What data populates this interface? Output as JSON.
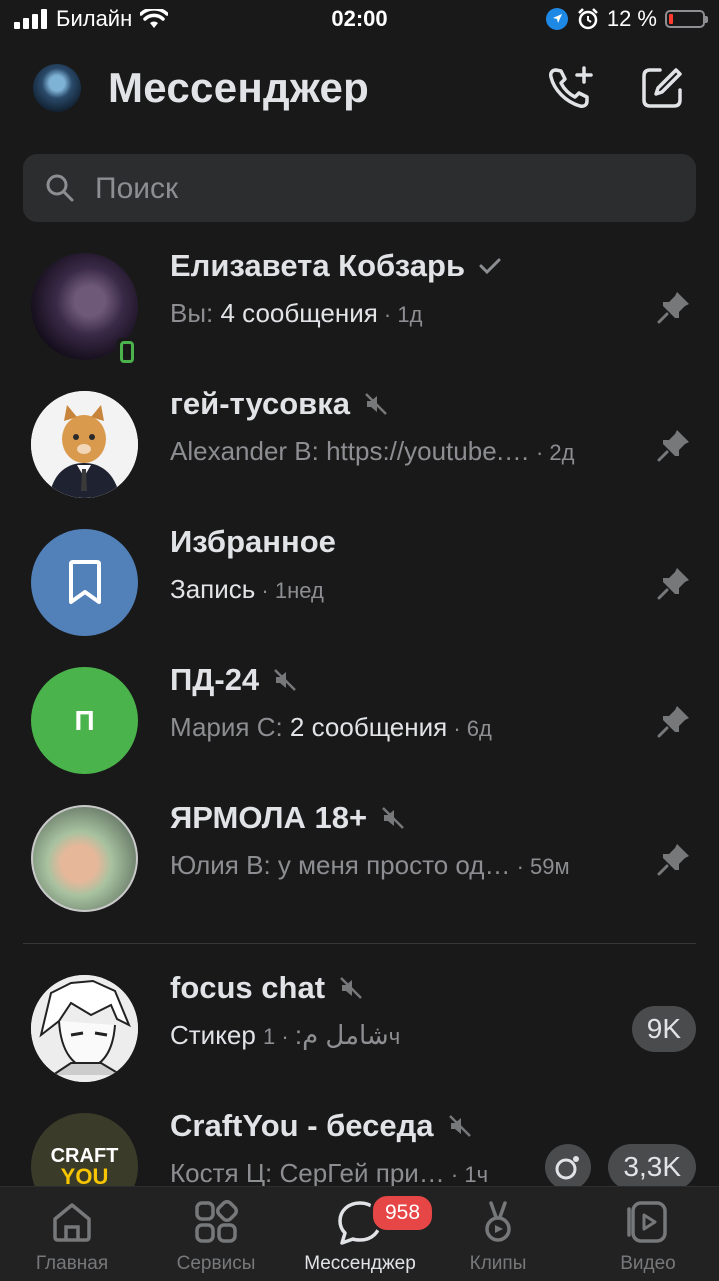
{
  "status_bar": {
    "carrier": "Билайн",
    "time": "02:00",
    "battery_percent": "12 %",
    "battery_level": 0.12
  },
  "header": {
    "title": "Мессенджер"
  },
  "search": {
    "placeholder": "Поиск"
  },
  "chats": [
    {
      "name": "Елизавета Кобзарь",
      "prefix": "Вы: ",
      "text": "4 сообщения",
      "time": " · 1д",
      "read_check": true,
      "pinned": true,
      "online_mobile": true
    },
    {
      "name": "гей-тусовка",
      "prefix": "Alexander B: https://youtube.…",
      "text": "",
      "time": " · 2д",
      "muted": true,
      "pinned": true
    },
    {
      "name": "Избранное",
      "prefix": "",
      "text": "Запись",
      "time": " · 1нед",
      "pinned": true
    },
    {
      "name": "ПД-24",
      "prefix": "Мария С: ",
      "text": "2 сообщения",
      "time": " · 6д",
      "muted": true,
      "pinned": true,
      "avatar_letter": "П"
    },
    {
      "name": "ЯРМОЛА 18+",
      "prefix": "Юлия В: у меня просто од…",
      "text": "",
      "time": " · 59м",
      "muted": true,
      "pinned": true
    },
    {
      "name": "focus chat",
      "prefix": "",
      "text": "Стикер ",
      "text2": "شامل م:",
      "time": " · 1ч",
      "muted": true,
      "unread": "9K"
    },
    {
      "name": "CraftYou - беседа",
      "prefix": "Костя Ц: СерГей при…",
      "text": "",
      "time": " · 1ч",
      "muted": true,
      "unread": "3,3K",
      "avatar_text1": "CRAFT",
      "avatar_text2": "YOU"
    }
  ],
  "tabs": [
    {
      "label": "Главная",
      "icon": "home-icon"
    },
    {
      "label": "Сервисы",
      "icon": "services-icon"
    },
    {
      "label": "Мессенджер",
      "icon": "messenger-icon",
      "badge": "958",
      "active": true
    },
    {
      "label": "Клипы",
      "icon": "clips-icon"
    },
    {
      "label": "Видео",
      "icon": "video-icon"
    }
  ],
  "colors": {
    "background": "#19191a",
    "accent_blue": "#5181b8",
    "green": "#4bb34b",
    "badge_red": "#e64646"
  }
}
